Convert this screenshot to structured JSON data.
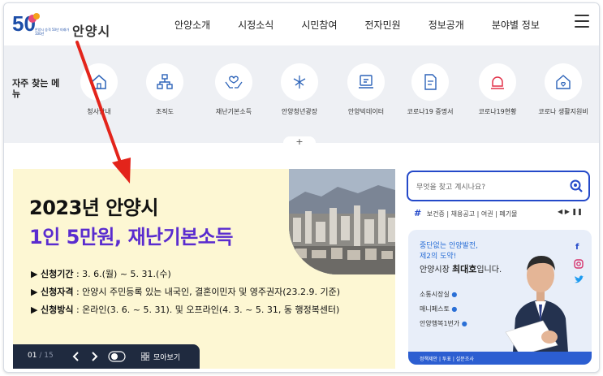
{
  "header": {
    "logo_number": "50",
    "logo_sub": "안양시 승격 50년 미래가 100년",
    "logo_name": "안양시",
    "nav": [
      "안양소개",
      "시정소식",
      "시민참여",
      "전자민원",
      "정보공개",
      "분야별 정보"
    ]
  },
  "quick": {
    "title": "자주 찾는 메뉴",
    "items": [
      {
        "label": "청사안내",
        "icon": "building-icon"
      },
      {
        "label": "조직도",
        "icon": "org-chart-icon"
      },
      {
        "label": "재난기본소득",
        "icon": "hands-heart-icon"
      },
      {
        "label": "안양청년광장",
        "icon": "youth-plaza-icon"
      },
      {
        "label": "안양빅데이터",
        "icon": "big-data-icon"
      },
      {
        "label": "코로나19 증명서",
        "icon": "certificate-icon"
      },
      {
        "label": "코로나19현황",
        "icon": "siren-icon"
      },
      {
        "label": "코로나 생활지원비",
        "icon": "support-home-icon"
      }
    ],
    "expand": "+"
  },
  "banner": {
    "title1": "2023년 안양시",
    "title2": "1인 5만원, 재난기본소득",
    "lines": [
      {
        "label": "신청기간",
        "text": " : 3. 6.(월) ~ 5. 31.(수)"
      },
      {
        "label": "신청자격",
        "text": " : 안양시 주민등록 있는 내국인, 결혼이민자 및 영주권자(23.2.9. 기준)"
      },
      {
        "label": "신청방식",
        "text": " : 온라인(3. 6. ~ 5. 31). 및 오프라인(4. 3. ~ 5. 31, 동 행정복센터)"
      }
    ],
    "pager": {
      "current": "01",
      "total": "15",
      "view_all": "모아보기"
    }
  },
  "search": {
    "placeholder": "무엇을 찾고 계시나요?",
    "tags": [
      "보건증",
      "채용공고",
      "여권",
      "폐기물"
    ]
  },
  "mayor": {
    "line1": "중단없는 안양발전,",
    "line2": "제2의 도약!",
    "line3_prefix": "안양시장 ",
    "line3_name": "최대호",
    "line3_suffix": "입니다.",
    "links": [
      "소통시장실",
      "매니페스토",
      "안양행복1번가"
    ],
    "bottom": "정책제안 | 투표 | 설문조사",
    "social": [
      "f",
      "ig",
      "tw"
    ]
  },
  "colors": {
    "accent": "#2449c9",
    "purple": "#5a2ccf",
    "banner_bg": "#fdf7d3",
    "arrow": "#e3241b"
  }
}
